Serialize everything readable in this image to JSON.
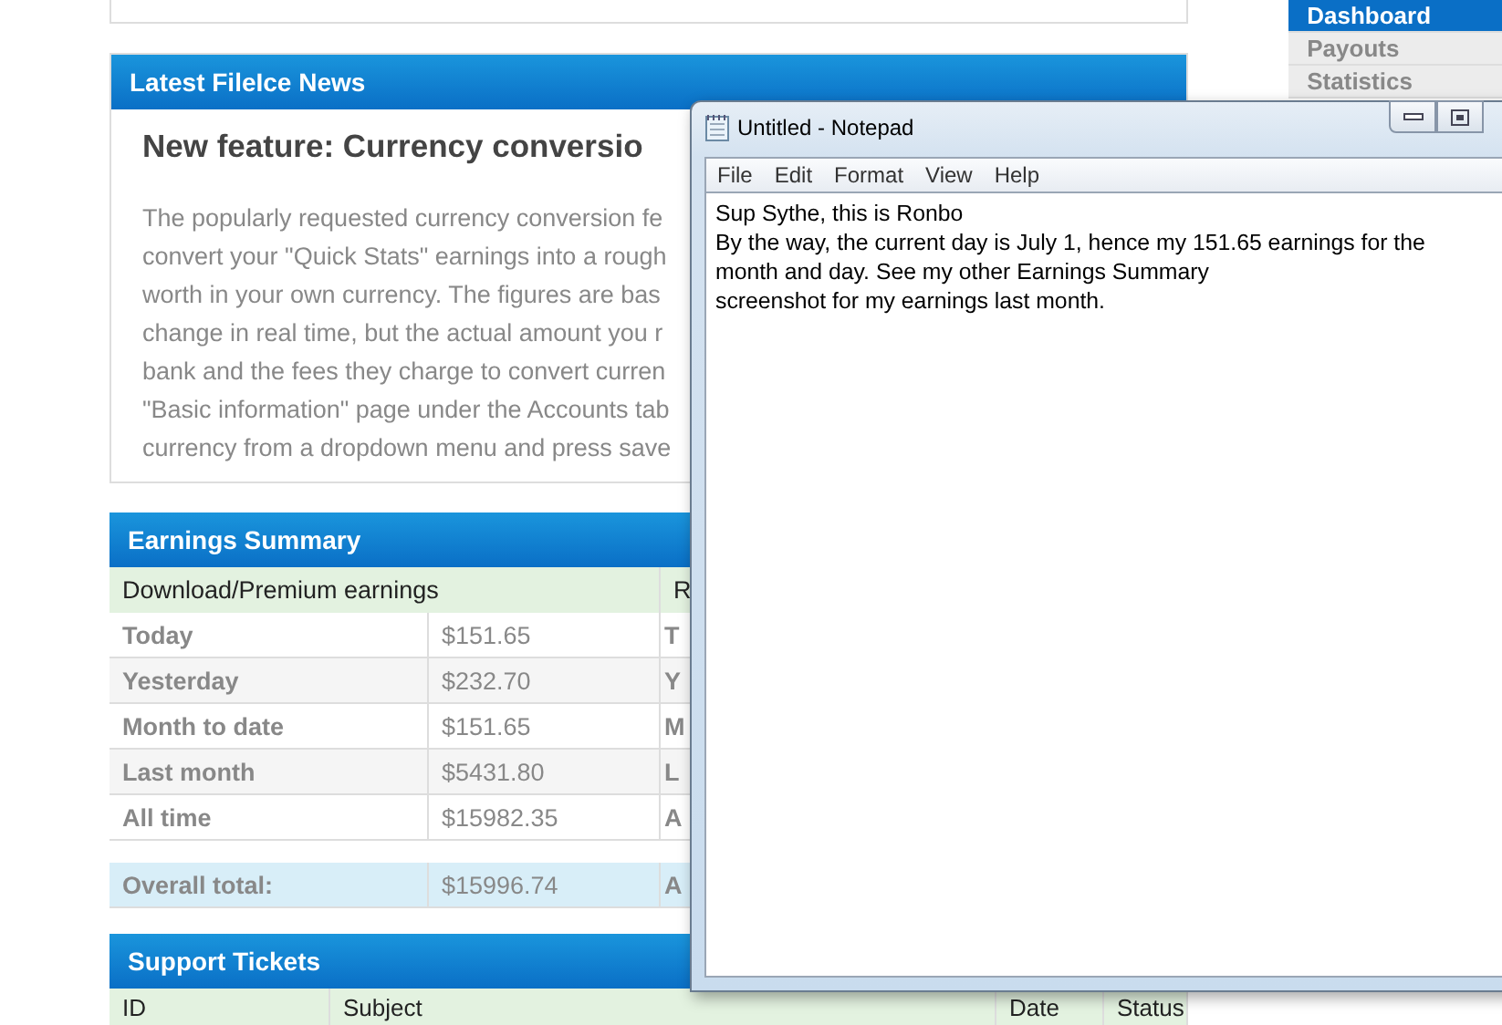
{
  "sidebar": {
    "items": [
      {
        "label": "Dashboard",
        "selected": true
      },
      {
        "label": "Payouts",
        "selected": false
      },
      {
        "label": "Statistics",
        "selected": false
      }
    ]
  },
  "news": {
    "title": "Latest FileIce News",
    "headline": "New feature: Currency conversio",
    "lines": [
      "The popularly requested currency conversion fe",
      "convert your \"Quick Stats\" earnings into a rough",
      "worth in your own currency. The figures are bas",
      "change in real time, but the actual amount you r",
      "bank and the fees they charge to convert curren",
      "\"Basic information\" page under the Accounts tab",
      "currency from a dropdown menu and press save"
    ]
  },
  "earnings": {
    "title": "Earnings Summary",
    "header": [
      "Download/Premium earnings",
      "R"
    ],
    "rows": [
      {
        "label": "Today",
        "value": "$151.65",
        "column_3": "T"
      },
      {
        "label": "Yesterday",
        "value": "$232.70",
        "column_3": "Y"
      },
      {
        "label": "Month to date",
        "value": "$151.65",
        "column_3": "M"
      },
      {
        "label": "Last month",
        "value": "$5431.80",
        "column_3": "L"
      },
      {
        "label": "All time",
        "value": "$15982.35",
        "column_3": "A"
      }
    ],
    "total": {
      "label": "Overall total:",
      "value": "$15996.74",
      "column_3": "A"
    }
  },
  "tickets": {
    "title": "Support Tickets",
    "columns": [
      "ID",
      "Subject",
      "Date",
      "Status"
    ]
  },
  "notepad": {
    "title": "Untitled - Notepad",
    "menu": [
      "File",
      "Edit",
      "Format",
      "View",
      "Help"
    ],
    "lines": [
      "Sup Sythe, this is Ronbo",
      "By the way, the current day is July 1, hence my 151.65 earnings for the",
      "month and day. See my other Earnings Summary",
      "screenshot for my earnings last month."
    ]
  }
}
